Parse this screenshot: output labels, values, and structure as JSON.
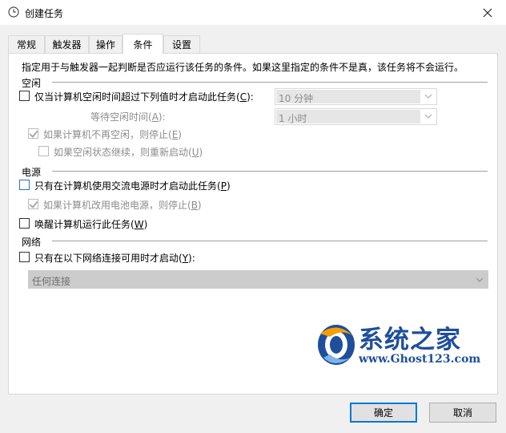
{
  "window": {
    "title": "创建任务"
  },
  "tabs": [
    {
      "label": "常规"
    },
    {
      "label": "触发器"
    },
    {
      "label": "操作"
    },
    {
      "label": "条件"
    },
    {
      "label": "设置"
    }
  ],
  "panel": {
    "description": "指定用于与触发器一起判断是否应运行该任务的条件。如果这里指定的条件不是真，该任务将不会运行。",
    "idle": {
      "group_label": "空闲",
      "start_if_idle": {
        "label": "仅当计算机空闲时间超过下列值时才启动此任务(",
        "key": "C",
        "suffix": "):",
        "checked": false
      },
      "idle_duration": {
        "value": "10 分钟"
      },
      "wait_label": {
        "label": "等待空闲时间(",
        "key": "A",
        "suffix": "):"
      },
      "wait_duration": {
        "value": "1 小时"
      },
      "stop_if_not_idle": {
        "label": "如果计算机不再空闲，则停止(",
        "key": "E",
        "suffix": ")",
        "checked": true,
        "enabled": false
      },
      "restart_if_idle": {
        "label": "如果空闲状态继续，则重新启动(",
        "key": "U",
        "suffix": ")",
        "checked": false,
        "enabled": false
      }
    },
    "power": {
      "group_label": "电源",
      "ac_only": {
        "label": "只有在计算机使用交流电源时才启动此任务(",
        "key": "P",
        "suffix": ")",
        "checked": false
      },
      "stop_on_battery": {
        "label": "如果计算机改用电池电源，则停止(",
        "key": "B",
        "suffix": ")",
        "checked": true,
        "enabled": false
      },
      "wake": {
        "label": "唤醒计算机运行此任务(",
        "key": "W",
        "suffix": ")",
        "checked": false
      }
    },
    "network": {
      "group_label": "网络",
      "only_if_network": {
        "label": "只有在以下网络连接可用时才启动(",
        "key": "Y",
        "suffix": "):",
        "checked": false
      },
      "connection": {
        "value": "任何连接"
      }
    }
  },
  "watermark": {
    "title": "系统之家",
    "url": "www.Ghost123.com"
  },
  "buttons": {
    "ok": "确定",
    "cancel": "取消"
  }
}
